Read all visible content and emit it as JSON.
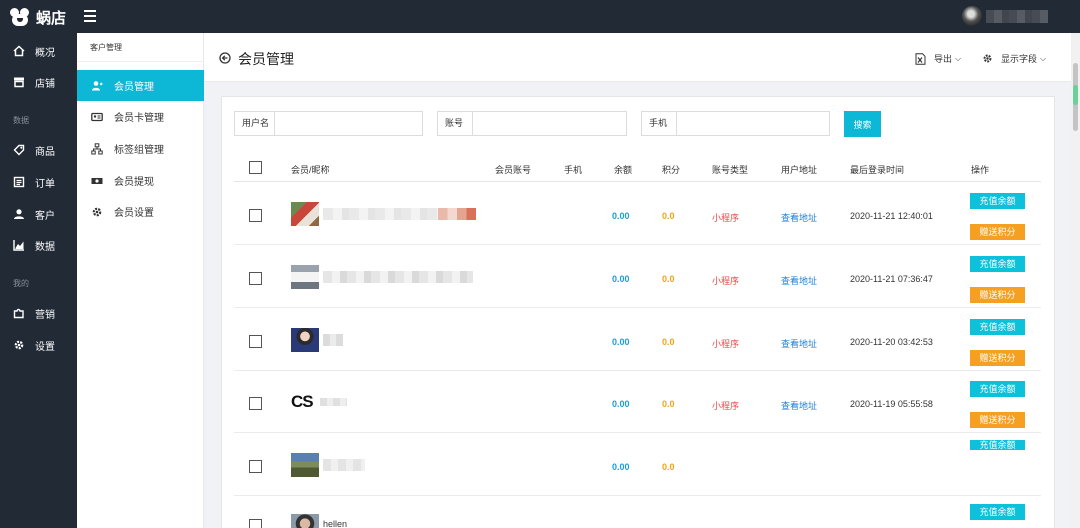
{
  "app": {
    "brand": "蜗店"
  },
  "sidebar": {
    "items": [
      {
        "label": "概况",
        "icon": "home-icon"
      },
      {
        "label": "店铺",
        "icon": "store-icon"
      },
      {
        "label": "商品",
        "icon": "tag-icon"
      },
      {
        "label": "订单",
        "icon": "order-icon"
      },
      {
        "label": "客户",
        "icon": "user-icon"
      },
      {
        "label": "数据",
        "icon": "chart-icon"
      },
      {
        "label": "营销",
        "icon": "puzzle-icon"
      },
      {
        "label": "设置",
        "icon": "gear-icon"
      }
    ],
    "groups": [
      "数据",
      "我的"
    ]
  },
  "subnav": {
    "header": "客户管理",
    "items": [
      {
        "label": "会员管理",
        "icon": "member-icon"
      },
      {
        "label": "会员卡管理",
        "icon": "card-icon"
      },
      {
        "label": "标签组管理",
        "icon": "tag-group-icon"
      },
      {
        "label": "会员提现",
        "icon": "withdraw-icon"
      },
      {
        "label": "会员设置",
        "icon": "gear-icon"
      }
    ],
    "active": "会员管理"
  },
  "header": {
    "title": "会员管理",
    "export_label": "导出",
    "fields_label": "显示字段"
  },
  "filters": {
    "username_label": "用户名",
    "account_label": "账号",
    "phone_label": "手机",
    "search_label": "搜索"
  },
  "table": {
    "columns": [
      "会员/昵称",
      "会员账号",
      "手机",
      "余额",
      "积分",
      "账号类型",
      "用户地址",
      "最后登录时间",
      "操作"
    ],
    "rows": [
      {
        "nickname": "",
        "balance": "0.00",
        "points": "0.0",
        "type": "小程序",
        "address": "查看地址",
        "last_login": "2020-11-21 12:40:01",
        "topup": "充值余额",
        "gift": "赠送积分"
      },
      {
        "nickname": "",
        "balance": "0.00",
        "points": "0.0",
        "type": "小程序",
        "address": "查看地址",
        "last_login": "2020-11-21 07:36:47",
        "topup": "充值余额",
        "gift": "赠送积分"
      },
      {
        "nickname": "",
        "balance": "0.00",
        "points": "0.0",
        "type": "小程序",
        "address": "查看地址",
        "last_login": "2020-11-20 03:42:53",
        "topup": "充值余额",
        "gift": "赠送积分"
      },
      {
        "nickname": "CS",
        "balance": "0.00",
        "points": "0.0",
        "type": "小程序",
        "address": "查看地址",
        "last_login": "2020-11-19 05:55:58",
        "topup": "充值余额",
        "gift": "赠送积分"
      },
      {
        "nickname": "",
        "balance": "0.00",
        "points": "0.0",
        "type": "",
        "address": "",
        "last_login": "",
        "topup": "充值余额",
        "gift": ""
      },
      {
        "nickname": "hellen",
        "balance": "",
        "points": "",
        "type": "",
        "address": "",
        "last_login": "",
        "topup": "充值余额",
        "gift": ""
      }
    ]
  },
  "colors": {
    "sidebar_bg": "#222a36",
    "accent": "#0cb8d5",
    "balance": "#1e9bdc",
    "points": "#f3a21a",
    "type": "#e84a4a",
    "gift_button": "#f5a020"
  }
}
